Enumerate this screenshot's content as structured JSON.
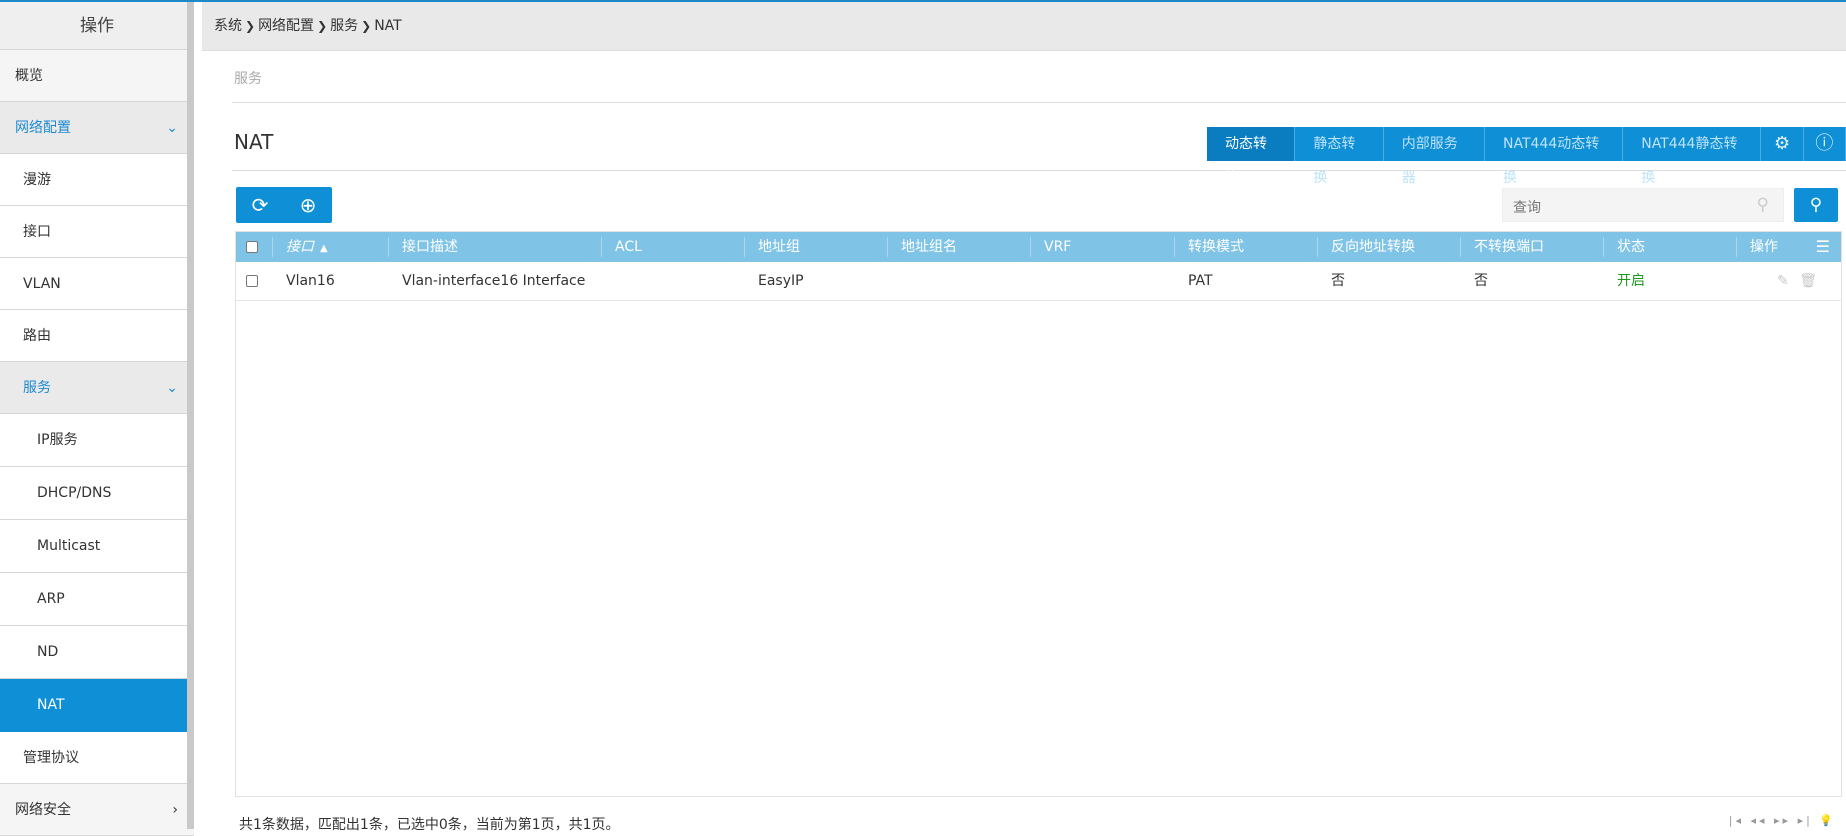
{
  "sidebar": {
    "header": "操作",
    "items": [
      {
        "label": "概览"
      },
      {
        "label": "网络配置"
      },
      {
        "label": "漫游"
      },
      {
        "label": "接口"
      },
      {
        "label": "VLAN"
      },
      {
        "label": "路由"
      },
      {
        "label": "服务"
      },
      {
        "label": "IP服务"
      },
      {
        "label": "DHCP/DNS"
      },
      {
        "label": "Multicast"
      },
      {
        "label": "ARP"
      },
      {
        "label": "ND"
      },
      {
        "label": "NAT"
      },
      {
        "label": "管理协议"
      },
      {
        "label": "网络安全"
      }
    ]
  },
  "breadcrumb": [
    "系统",
    "网络配置",
    "服务",
    "NAT"
  ],
  "sub_tab": "服务",
  "page_title": "NAT",
  "tabs": [
    "动态转换",
    "静态转换",
    "内部服务器",
    "NAT444动态转换",
    "NAT444静态转换"
  ],
  "search": {
    "placeholder": "查询"
  },
  "table": {
    "headers": [
      "接口",
      "接口描述",
      "ACL",
      "地址组",
      "地址组名",
      "VRF",
      "转换模式",
      "反向地址转换",
      "不转换端口",
      "状态",
      "操作"
    ],
    "rows": [
      {
        "interface": "Vlan16",
        "description": "Vlan-interface16 Interface",
        "acl": "",
        "addr_group": "EasyIP",
        "addr_group_name": "",
        "vrf": "",
        "mode": "PAT",
        "reverse": "否",
        "no_pat": "否",
        "status": "开启"
      }
    ]
  },
  "footer": "共1条数据，匹配出1条，已选中0条，当前为第1页，共1页。",
  "colors": {
    "accent": "#0e8fd6",
    "header_row": "#7fc3e7",
    "status_on": "#1c9a1c"
  }
}
